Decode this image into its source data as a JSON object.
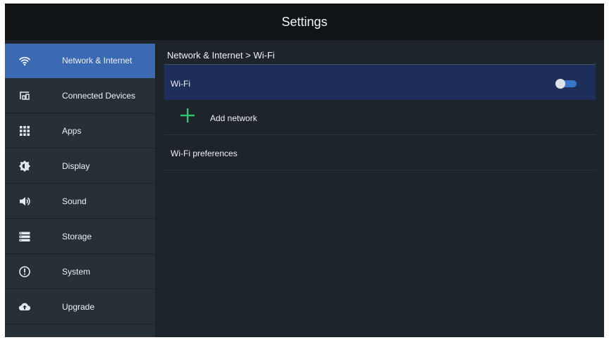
{
  "header": {
    "title": "Settings"
  },
  "sidebar": {
    "items": [
      {
        "label": "Network & Internet",
        "icon": "wifi-icon",
        "active": true
      },
      {
        "label": "Connected Devices",
        "icon": "connected-devices-icon"
      },
      {
        "label": "Apps",
        "icon": "apps-grid-icon"
      },
      {
        "label": "Display",
        "icon": "brightness-icon"
      },
      {
        "label": "Sound",
        "icon": "speaker-icon"
      },
      {
        "label": "Storage",
        "icon": "storage-icon"
      },
      {
        "label": "System",
        "icon": "info-circle-icon"
      },
      {
        "label": "Upgrade",
        "icon": "cloud-upload-icon"
      }
    ]
  },
  "content": {
    "breadcrumb": "Network & Internet > Wi-Fi",
    "wifi": {
      "label": "Wi-Fi",
      "enabled": false
    },
    "add_network": {
      "label": "Add network",
      "icon": "plus-icon"
    },
    "preferences": {
      "label": "Wi-Fi preferences"
    }
  },
  "colors": {
    "background": "#1d252b",
    "header": "#101417",
    "sidebar": "#263036",
    "active_item": "#3b6ab2",
    "selected_row": "#1e2e5a",
    "accent_green": "#2ec46e",
    "toggle_track": "#3a76c8"
  }
}
